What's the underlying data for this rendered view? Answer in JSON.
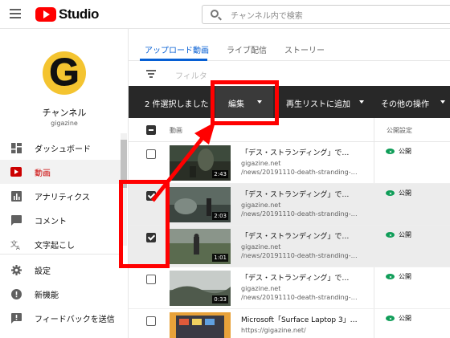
{
  "app": {
    "logo_text": "Studio",
    "search_placeholder": "チャンネル内で検索"
  },
  "channel": {
    "avatar_letter": "G",
    "name": "チャンネル",
    "handle": "gigazine"
  },
  "sidebar": {
    "items": [
      {
        "label": "ダッシュボード",
        "icon": "dashboard-icon",
        "active": false
      },
      {
        "label": "動画",
        "icon": "video-icon",
        "active": true
      },
      {
        "label": "アナリティクス",
        "icon": "analytics-icon",
        "active": false
      },
      {
        "label": "コメント",
        "icon": "comment-icon",
        "active": false
      },
      {
        "label": "文字起こし",
        "icon": "translation-icon",
        "active": false
      },
      {
        "label": "設定",
        "icon": "gear-icon",
        "active": false
      },
      {
        "label": "新機能",
        "icon": "alert-icon",
        "active": false
      },
      {
        "label": "フィードバックを送信",
        "icon": "feedback-icon",
        "active": false
      }
    ]
  },
  "tabs": [
    {
      "label": "アップロード動画",
      "active": true
    },
    {
      "label": "ライブ配信",
      "active": false
    },
    {
      "label": "ストーリー",
      "active": false
    }
  ],
  "filter": {
    "placeholder": "フィルタ"
  },
  "action_bar": {
    "selected_count": "2 件選択しました",
    "edit": "編集",
    "add_to_playlist": "再生リストに追加",
    "more_actions": "その他の操作"
  },
  "table": {
    "headers": {
      "video": "動画",
      "visibility": "公開設定"
    },
    "rows": [
      {
        "checked": false,
        "duration": "2:43",
        "title": "「デス・ストランディング」で…",
        "line1": "gigazine.net",
        "line2": "/news/20191110-death-stranding-…",
        "visibility": "公開"
      },
      {
        "checked": true,
        "duration": "2:03",
        "title": "「デス・ストランディング」で…",
        "line1": "gigazine.net",
        "line2": "/news/20191110-death-stranding-…",
        "visibility": "公開"
      },
      {
        "checked": true,
        "duration": "1:01",
        "title": "「デス・ストランディング」で…",
        "line1": "gigazine.net",
        "line2": "/news/20191110-death-stranding-…",
        "visibility": "公開"
      },
      {
        "checked": false,
        "duration": "0:33",
        "title": "「デス・ストランディング」で…",
        "line1": "gigazine.net",
        "line2": "/news/20191110-death-stranding-…",
        "visibility": "公開"
      },
      {
        "checked": false,
        "duration": "",
        "title": "Microsoft「Surface Laptop 3」…",
        "line1": "https://gigazine.net/",
        "line2": "",
        "visibility": "公開"
      }
    ]
  },
  "colors": {
    "accent": "#065fd4",
    "brand": "#ff0000",
    "annotation": "#ff0000",
    "public": "#0f9d58"
  }
}
